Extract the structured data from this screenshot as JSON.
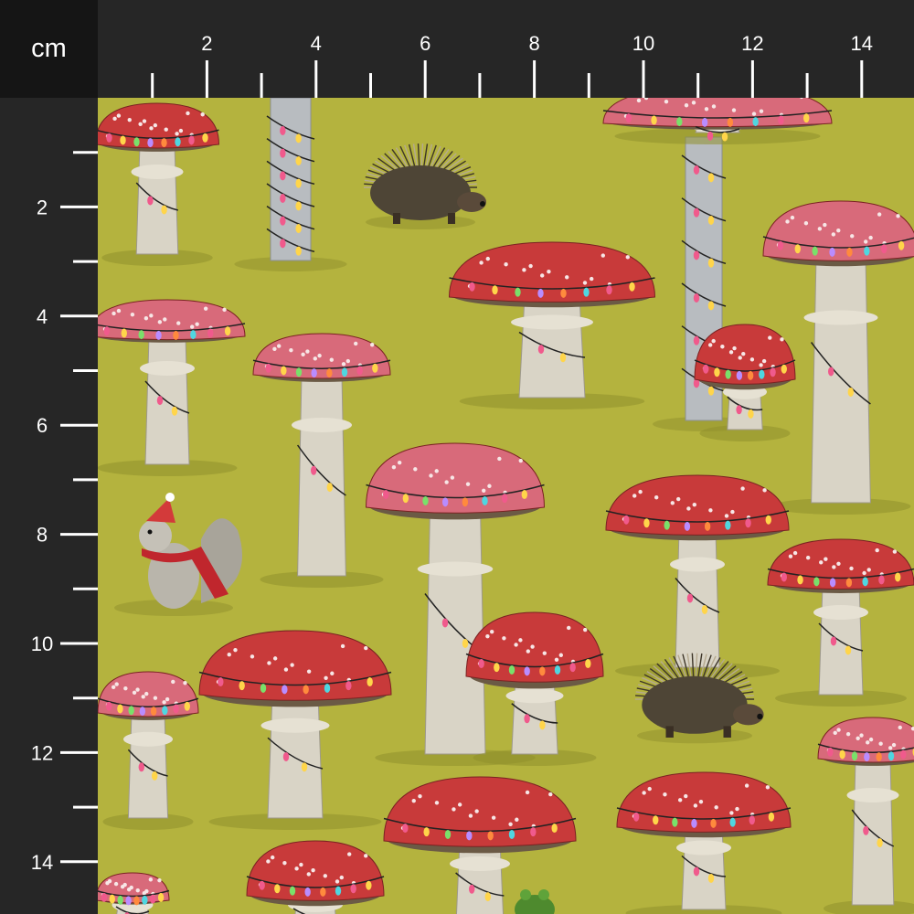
{
  "unit_label": "cm",
  "ruler_top": {
    "labels": [
      "2",
      "4",
      "6",
      "8",
      "10",
      "12",
      "14"
    ]
  },
  "ruler_left": {
    "labels": [
      "2",
      "4",
      "6",
      "8",
      "10",
      "12",
      "14"
    ]
  },
  "colors": {
    "ruler_background": "#262626",
    "corner_background": "#151515",
    "ruler_text": "#ffffff",
    "fabric_background": "#b4b33e",
    "cap_red": "#c83a3a",
    "cap_pink": "#d86a7a",
    "stem": "#d9d4c6"
  },
  "pattern": {
    "motifs": [
      "mushroom-icon",
      "porcupine-icon",
      "squirrel-icon",
      "string-lights-icon"
    ]
  }
}
